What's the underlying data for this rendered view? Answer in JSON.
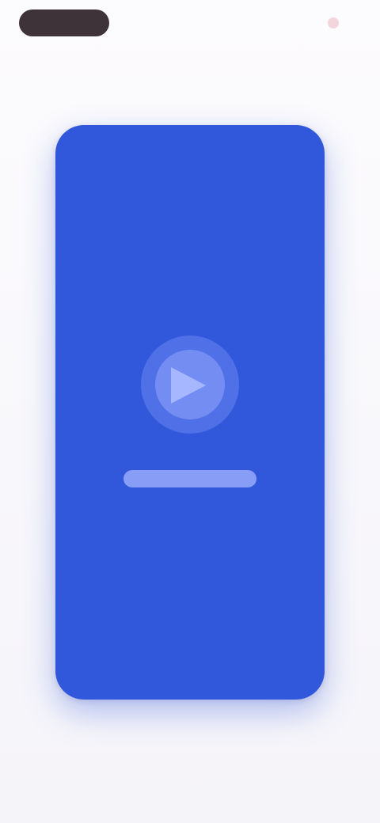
{
  "top_bar": {
    "left_pill_label": "",
    "right_dot_label": ""
  },
  "video": {
    "play_icon": "play-icon",
    "label": ""
  },
  "colors": {
    "background": "#f7f6fa",
    "card": "#3157db",
    "pill": "#3e3338",
    "dot": "#f3d6dc",
    "play_circle": "#8ca0ff",
    "play_glyph": "#a6b6ff"
  }
}
